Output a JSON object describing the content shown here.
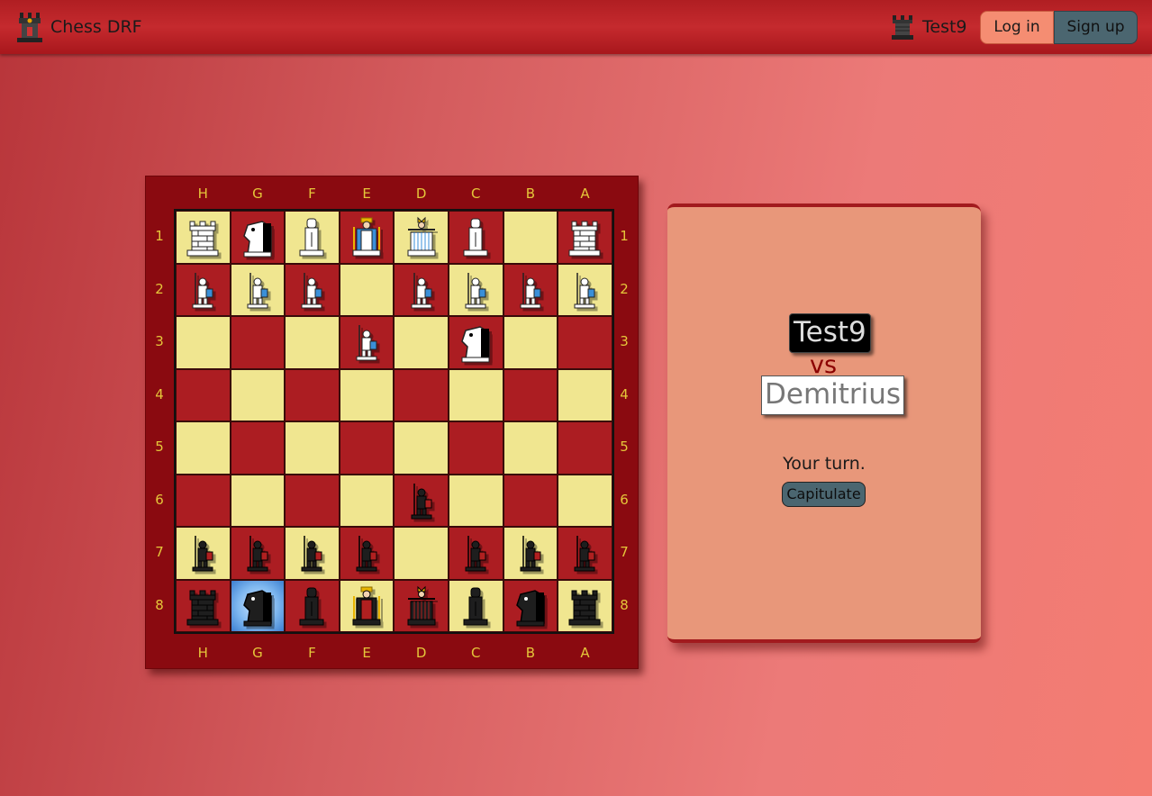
{
  "navbar": {
    "brand": "Chess DRF",
    "user": "Test9",
    "login_label": "Log in",
    "signup_label": "Sign up"
  },
  "board": {
    "files": [
      "H",
      "G",
      "F",
      "E",
      "D",
      "C",
      "B",
      "A"
    ],
    "ranks": [
      "1",
      "2",
      "3",
      "4",
      "5",
      "6",
      "7",
      "8"
    ],
    "rows": [
      [
        "wR",
        "wN",
        "wB",
        "wK",
        "wQ",
        "wB",
        "",
        "wR"
      ],
      [
        "wP",
        "wP",
        "wP",
        "",
        "wP",
        "wP",
        "wP",
        "wP"
      ],
      [
        "",
        "",
        "",
        "wP",
        "",
        "wN",
        "",
        ""
      ],
      [
        "",
        "",
        "",
        "",
        "",
        "",
        "",
        ""
      ],
      [
        "",
        "",
        "",
        "",
        "",
        "",
        "",
        ""
      ],
      [
        "",
        "",
        "",
        "",
        "bP",
        "",
        "",
        ""
      ],
      [
        "bP",
        "bP",
        "bP",
        "bP",
        "",
        "bP",
        "bP",
        "bP"
      ],
      [
        "bR",
        "bN",
        "bB",
        "bK",
        "bQ",
        "bB",
        "bN",
        "bR"
      ]
    ],
    "selected_square": "G8",
    "colors": {
      "light": "#f0e690",
      "dark": "#ac1d22",
      "frame": "#8a0a10",
      "coords": "#e5c63a"
    }
  },
  "game": {
    "player1": "Test9",
    "vs": "vs",
    "player2": "Demitrius",
    "status": "Your turn.",
    "capitulate_label": "Capitulate"
  }
}
